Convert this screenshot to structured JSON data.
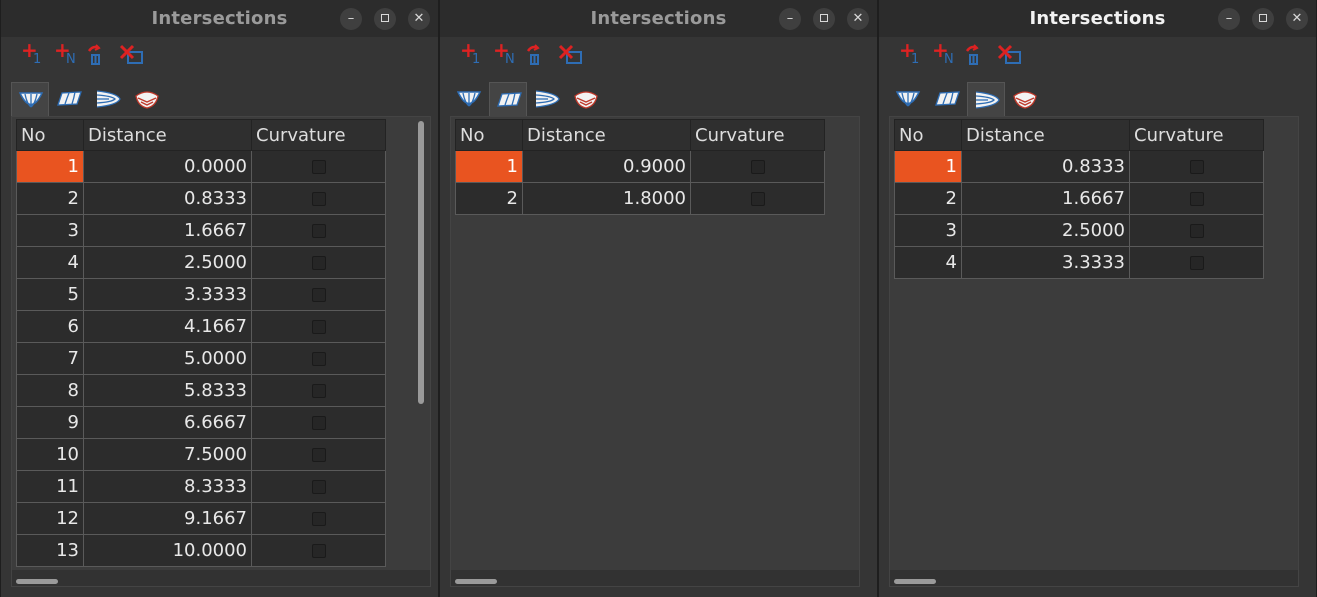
{
  "windows": [
    {
      "title": "Intersections",
      "active": false,
      "buttons": {
        "minimize": "–",
        "close": "✕"
      },
      "toolbar": [
        {
          "icon": "add-one-icon",
          "sub": "1"
        },
        {
          "icon": "add-n-icon",
          "sub": "N"
        },
        {
          "icon": "delete-icon"
        },
        {
          "icon": "remove-all-icon"
        }
      ],
      "tabs": [
        "stations-tab-icon",
        "buttocks-tab-icon",
        "waterlines-tab-icon",
        "diagonals-tab-icon"
      ],
      "selected_tab": 0,
      "columns": [
        "No",
        "Distance",
        "Curvature"
      ],
      "rows": [
        {
          "no": "1",
          "distance": "0.0000"
        },
        {
          "no": "2",
          "distance": "0.8333"
        },
        {
          "no": "3",
          "distance": "1.6667"
        },
        {
          "no": "4",
          "distance": "2.5000"
        },
        {
          "no": "5",
          "distance": "3.3333"
        },
        {
          "no": "6",
          "distance": "4.1667"
        },
        {
          "no": "7",
          "distance": "5.0000"
        },
        {
          "no": "8",
          "distance": "5.8333"
        },
        {
          "no": "9",
          "distance": "6.6667"
        },
        {
          "no": "10",
          "distance": "7.5000"
        },
        {
          "no": "11",
          "distance": "8.3333"
        },
        {
          "no": "12",
          "distance": "9.1667"
        },
        {
          "no": "13",
          "distance": "10.0000"
        }
      ],
      "selected_row": 0,
      "has_vscroll": true
    },
    {
      "title": "Intersections",
      "active": false,
      "buttons": {
        "minimize": "–",
        "close": "✕"
      },
      "toolbar": [
        {
          "icon": "add-one-icon",
          "sub": "1"
        },
        {
          "icon": "add-n-icon",
          "sub": "N"
        },
        {
          "icon": "delete-icon"
        },
        {
          "icon": "remove-all-icon"
        }
      ],
      "tabs": [
        "stations-tab-icon",
        "buttocks-tab-icon",
        "waterlines-tab-icon",
        "diagonals-tab-icon"
      ],
      "selected_tab": 1,
      "columns": [
        "No",
        "Distance",
        "Curvature"
      ],
      "rows": [
        {
          "no": "1",
          "distance": "0.9000"
        },
        {
          "no": "2",
          "distance": "1.8000"
        }
      ],
      "selected_row": 0,
      "has_vscroll": false
    },
    {
      "title": "Intersections",
      "active": true,
      "buttons": {
        "minimize": "–",
        "close": "✕"
      },
      "toolbar": [
        {
          "icon": "add-one-icon",
          "sub": "1"
        },
        {
          "icon": "add-n-icon",
          "sub": "N"
        },
        {
          "icon": "delete-icon"
        },
        {
          "icon": "remove-all-icon"
        }
      ],
      "tabs": [
        "stations-tab-icon",
        "buttocks-tab-icon",
        "waterlines-tab-icon",
        "diagonals-tab-icon"
      ],
      "selected_tab": 2,
      "columns": [
        "No",
        "Distance",
        "Curvature"
      ],
      "rows": [
        {
          "no": "1",
          "distance": "0.8333"
        },
        {
          "no": "2",
          "distance": "1.6667"
        },
        {
          "no": "3",
          "distance": "2.5000"
        },
        {
          "no": "4",
          "distance": "3.3333"
        }
      ],
      "selected_row": 0,
      "has_vscroll": false
    }
  ]
}
